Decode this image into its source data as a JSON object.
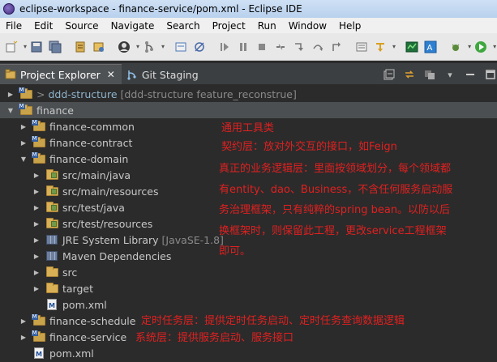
{
  "window": {
    "title": "eclipse-workspace - finance-service/pom.xml - Eclipse IDE"
  },
  "menu": [
    "File",
    "Edit",
    "Source",
    "Navigate",
    "Search",
    "Project",
    "Run",
    "Window",
    "Help"
  ],
  "tabs": {
    "project_explorer": "Project Explorer",
    "project_explorer_close": "✕",
    "git_staging": "Git Staging"
  },
  "tree": {
    "ddd_structure": {
      "git_mark": ">",
      "name": "ddd-structure",
      "suffix": "[ddd-structure feature_reconstrue]"
    },
    "finance": "finance",
    "finance_common": "finance-common",
    "finance_contract": "finance-contract",
    "finance_domain": "finance-domain",
    "src_main_java": "src/main/java",
    "src_main_resources": "src/main/resources",
    "src_test_java": "src/test/java",
    "src_test_resources": "src/test/resources",
    "jre": {
      "name": "JRE System Library",
      "suffix": "[JavaSE-1.8]"
    },
    "maven_deps": "Maven Dependencies",
    "src": "src",
    "target": "target",
    "domain_pom": "pom.xml",
    "finance_schedule": "finance-schedule",
    "finance_service": "finance-service",
    "root_pom": "pom.xml"
  },
  "annotations": {
    "common": "通用工具类",
    "contract": "契约层：放对外交互的接口，如Feign",
    "domain_line1": "真正的业务逻辑层：里面按领域划分，每个领域都",
    "domain_line2": "有entity、dao、Business，不含任何服务启动服",
    "domain_line3": "务治理框架，只有纯粹的spring bean。以防以后",
    "domain_line4": "换框架时，则保留此工程，更改service工程框架",
    "domain_line5": "即可。",
    "schedule": "定时任务层：提供定时任务启动、定时任务查询数据逻辑",
    "service": "系统层：提供服务启动、服务接口"
  },
  "colors": {
    "annotation": "#e02020",
    "tree_background": "#2b2b2b",
    "selected_row": "#4b4f52"
  }
}
